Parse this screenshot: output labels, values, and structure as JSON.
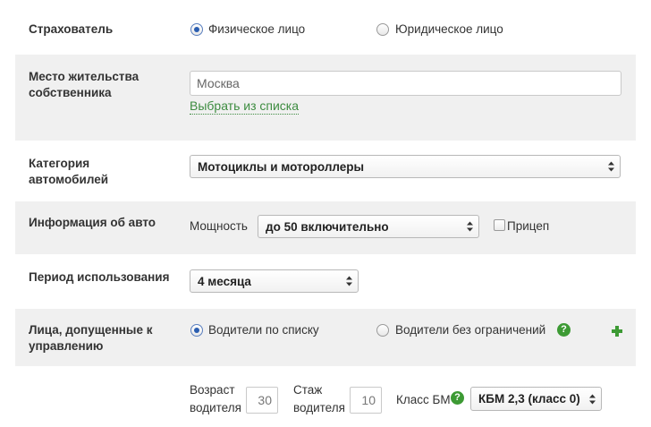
{
  "insurer": {
    "label": "Страхователь",
    "options": [
      {
        "label": "Физическое лицо",
        "checked": true
      },
      {
        "label": "Юридическое лицо",
        "checked": false
      }
    ]
  },
  "residence": {
    "label_line1": "Место жительства",
    "label_line2": "собственника",
    "value": "Москва",
    "choose_link": "Выбрать из списка"
  },
  "category": {
    "label_line1": "Категория",
    "label_line2": "автомобилей",
    "selected": "Мотоциклы и мотороллеры"
  },
  "car_info": {
    "label": "Информация об авто",
    "power_label": "Мощность",
    "power_selected": "до 50 включительно",
    "trailer_label": "Прицеп",
    "trailer_checked": false
  },
  "period": {
    "label": "Период использования",
    "selected": "4 месяца"
  },
  "drivers": {
    "label_line1": "Лица, допущенные к",
    "label_line2": "управлению",
    "options": [
      {
        "label": "Водители по списку",
        "checked": true
      },
      {
        "label": "Водители без ограничений",
        "checked": false
      }
    ],
    "help": "?",
    "add_icon": "plus-icon"
  },
  "driver_row": {
    "age_label_line1": "Возраст",
    "age_label_line2": "водителя",
    "age_value": "30",
    "exp_label_line1": "Стаж",
    "exp_label_line2": "водителя",
    "exp_value": "10",
    "kbm_label": "Класс БМ",
    "kbm_help": "?",
    "kbm_selected": "КБМ 2,3 (класс 0)"
  },
  "colors": {
    "band": "#f0f0f0",
    "accent_green": "#3d9a34",
    "radio_blue": "#2a5db0"
  }
}
